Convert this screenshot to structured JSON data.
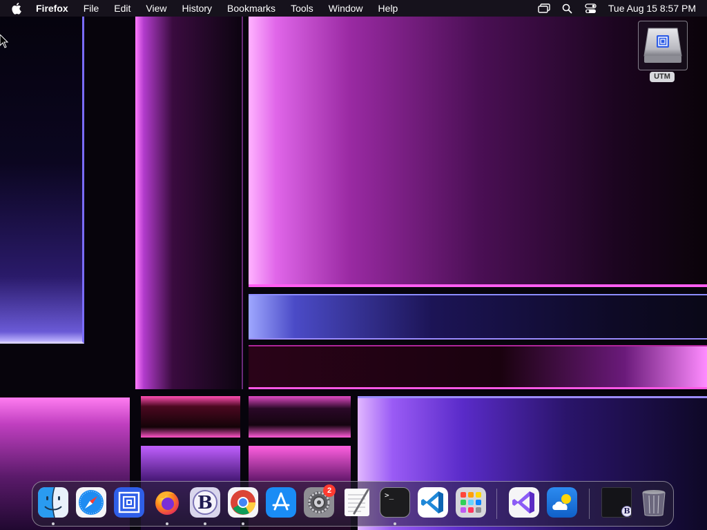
{
  "menubar": {
    "app_name": "Firefox",
    "menus": [
      "File",
      "Edit",
      "View",
      "History",
      "Bookmarks",
      "Tools",
      "Window",
      "Help"
    ],
    "status_icons": [
      "screen-mirroring-icon",
      "search-icon",
      "control-center-icon"
    ],
    "clock": "Tue Aug 15  8:57 PM"
  },
  "desktop": {
    "icons": [
      {
        "label": "UTM",
        "icon": "utm-disk-icon"
      }
    ]
  },
  "dock": {
    "apps": [
      {
        "name": "finder",
        "running": true
      },
      {
        "name": "safari",
        "running": false
      },
      {
        "name": "utm",
        "running": false
      },
      {
        "name": "firefox",
        "running": true
      },
      {
        "name": "bbedit",
        "running": true
      },
      {
        "name": "chrome",
        "running": true
      },
      {
        "name": "app-store",
        "running": false
      },
      {
        "name": "system-settings",
        "running": false,
        "badge": "2"
      },
      {
        "name": "textedit",
        "running": false
      },
      {
        "name": "terminal",
        "running": true
      },
      {
        "name": "vscode",
        "running": false
      },
      {
        "name": "launchpad",
        "running": false
      },
      {
        "name": "visual-studio",
        "running": false
      },
      {
        "name": "weather",
        "running": false
      },
      {
        "name": "minimized-window",
        "running": false
      },
      {
        "name": "trash",
        "running": false
      }
    ],
    "terminal_glyph": ">_",
    "bbedit_glyph": "B",
    "minimized_glyph": "B"
  },
  "colors": {
    "menubar_bg": "#18141e",
    "badge_red": "#ff3b30",
    "wallpaper_pink": "#ff5ef3",
    "wallpaper_violet": "#5a2bc9"
  }
}
